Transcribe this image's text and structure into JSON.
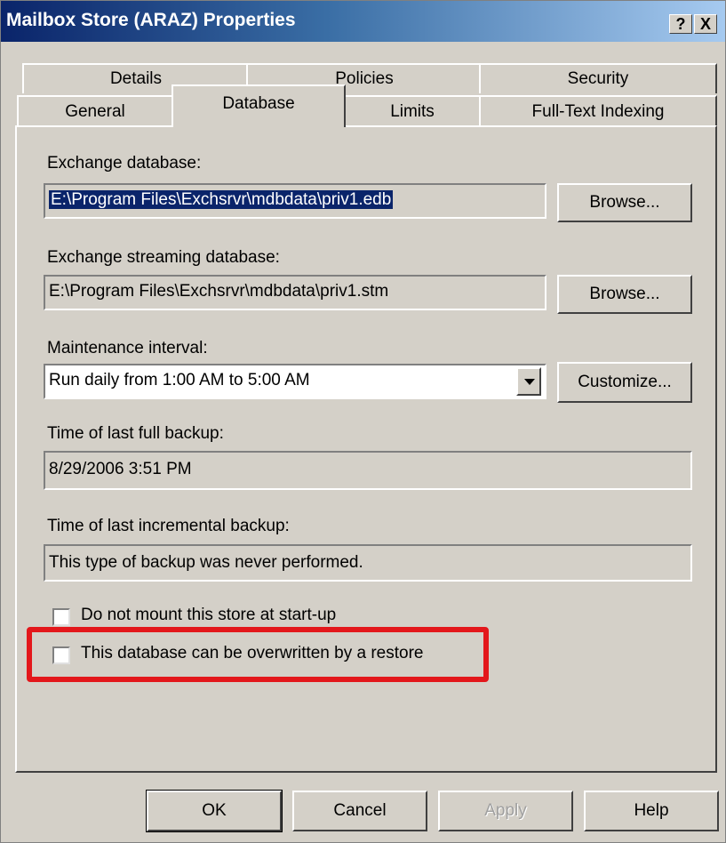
{
  "window": {
    "title": "Mailbox Store (ARAZ) Properties",
    "help_button": "?",
    "close_button": "X"
  },
  "tabs": {
    "row1": [
      "Details",
      "Policies",
      "Security"
    ],
    "row2": [
      "General",
      "Database",
      "Limits",
      "Full-Text Indexing"
    ],
    "active": "Database"
  },
  "exchange_database": {
    "label": "Exchange database:",
    "value": "E:\\Program Files\\Exchsrvr\\mdbdata\\priv1.edb",
    "browse_label": "Browse..."
  },
  "streaming_database": {
    "label": "Exchange streaming database:",
    "value": "E:\\Program Files\\Exchsrvr\\mdbdata\\priv1.stm",
    "browse_label": "Browse..."
  },
  "maintenance": {
    "label": "Maintenance interval:",
    "value": "Run daily from 1:00 AM to 5:00 AM",
    "customize_label": "Customize..."
  },
  "full_backup": {
    "label": "Time of last full backup:",
    "value": "8/29/2006  3:51 PM"
  },
  "incremental_backup": {
    "label": "Time of last incremental backup:",
    "value": "This type of backup was never performed."
  },
  "checkboxes": {
    "no_mount": {
      "label": "Do not mount this store at start-up",
      "checked": false
    },
    "overwrite": {
      "label": "This database can be overwritten by a restore",
      "checked": false
    }
  },
  "highlight_color": "#e3171b",
  "footer": {
    "ok": "OK",
    "cancel": "Cancel",
    "apply": "Apply",
    "help": "Help"
  }
}
